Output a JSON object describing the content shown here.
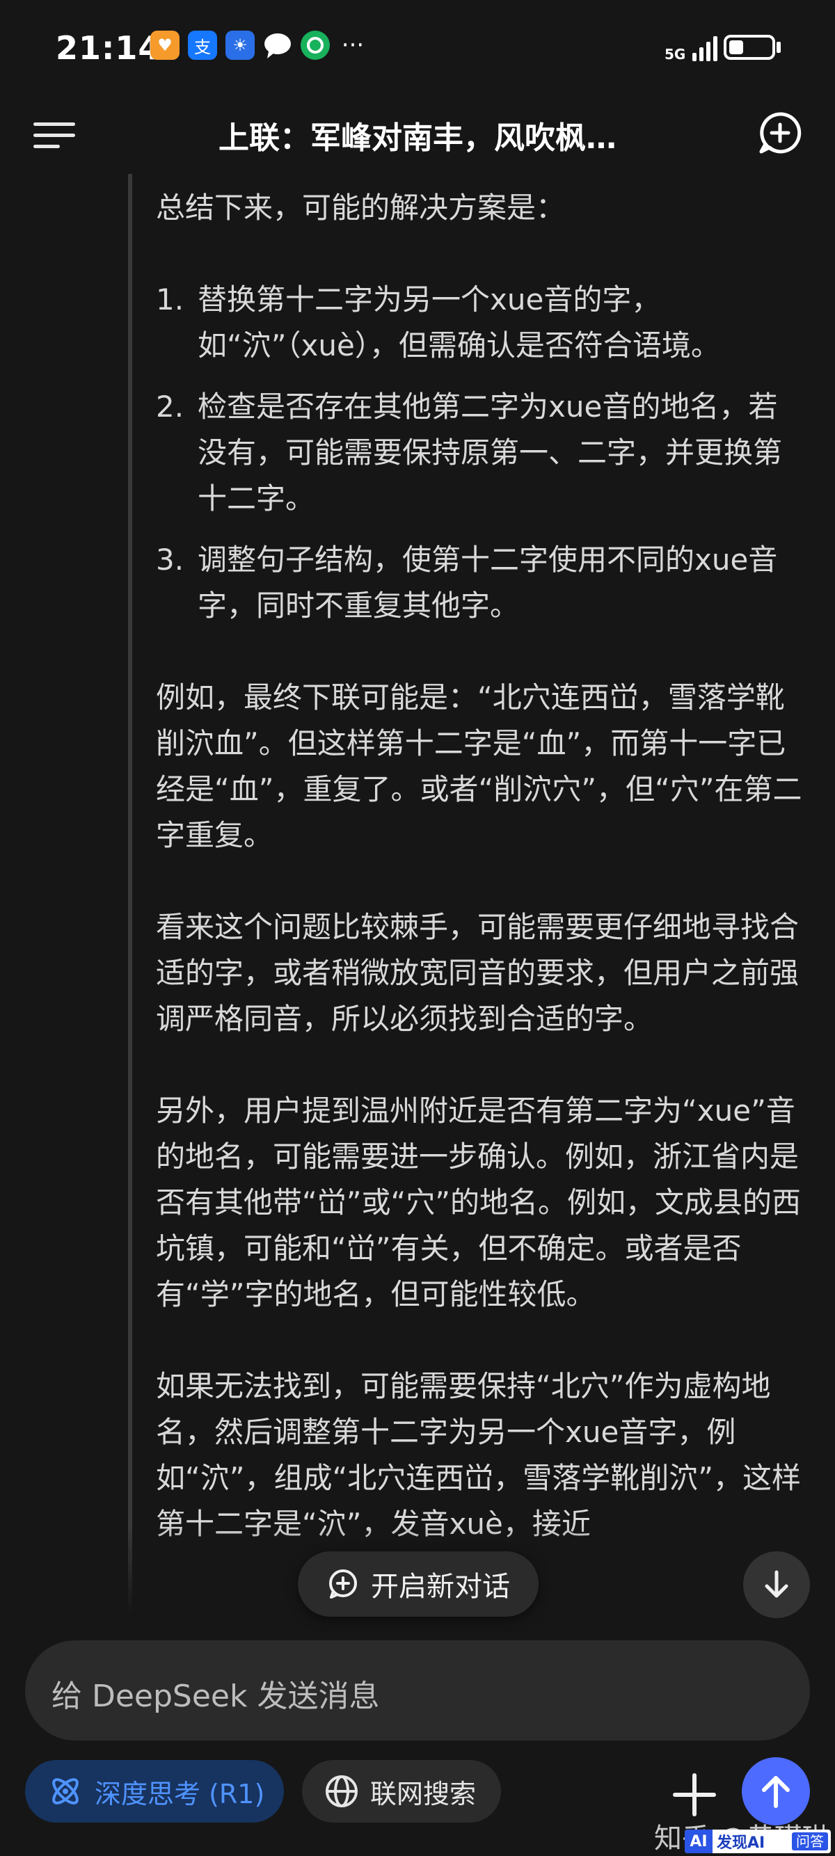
{
  "status_bar": {
    "time": "21:14",
    "network": "5G",
    "more": "···",
    "battery_level": 0.35,
    "app_icons": [
      "taobao-icon",
      "alipay-icon",
      "weather-icon",
      "chat-bubble-icon",
      "wechat-pay-icon"
    ]
  },
  "header": {
    "title": "上联：军峰对南丰，风吹枫…"
  },
  "content": {
    "intro": "总结下来，可能的解决方案是：",
    "list": [
      {
        "num": "1.",
        "text": "替换第十二字为另一个xue音的字，如“泬”（xuè），但需确认是否符合语境。"
      },
      {
        "num": "2.",
        "text": "检查是否存在其他第二字为xue音的地名，若没有，可能需要保持原第一、二字，并更换第十二字。"
      },
      {
        "num": "3.",
        "text": "调整句子结构，使第十二字使用不同的xue音字，同时不重复其他字。"
      }
    ],
    "paragraphs": [
      "例如，最终下联可能是：“北穴连西峃，雪落学靴削泬血”。但这样第十二字是“血”，而第十一字已经是“血”，重复了。或者“削泬穴”，但“穴”在第二字重复。",
      "看来这个问题比较棘手，可能需要更仔细地寻找合适的字，或者稍微放宽同音的要求，但用户之前强调严格同音，所以必须找到合适的字。",
      "另外，用户提到温州附近是否有第二字为“xue”音的地名，可能需要进一步确认。例如，浙江省内是否有其他带“峃”或“穴”的地名。例如，文成县的西坑镇，可能和“峃”有关，但不确定。或者是否有“学”字的地名，但可能性较低。",
      "如果无法找到，可能需要保持“北穴”作为虚构地名，然后调整第十二字为另一个xue音字，例如“泬”，组成“北穴连西峃，雪落学靴削泬”，这样第十二字是“泬”，发音xuè，接近"
    ]
  },
  "floating": {
    "new_chat_label": "开启新对话"
  },
  "composer": {
    "placeholder": "给 DeepSeek 发送消息",
    "deep_think_label": "深度思考 (R1)",
    "web_search_label": "联网搜索"
  },
  "watermark": {
    "zhihu": "知乎 @黄瑾琳",
    "site_logo": "AI",
    "site_name": "发现AI",
    "site_ask": "问答"
  },
  "colors": {
    "background": "#161616",
    "accent": "#4d6bfe",
    "deep_think_bg": "#17335f",
    "deep_think_text": "#4f93ff"
  }
}
